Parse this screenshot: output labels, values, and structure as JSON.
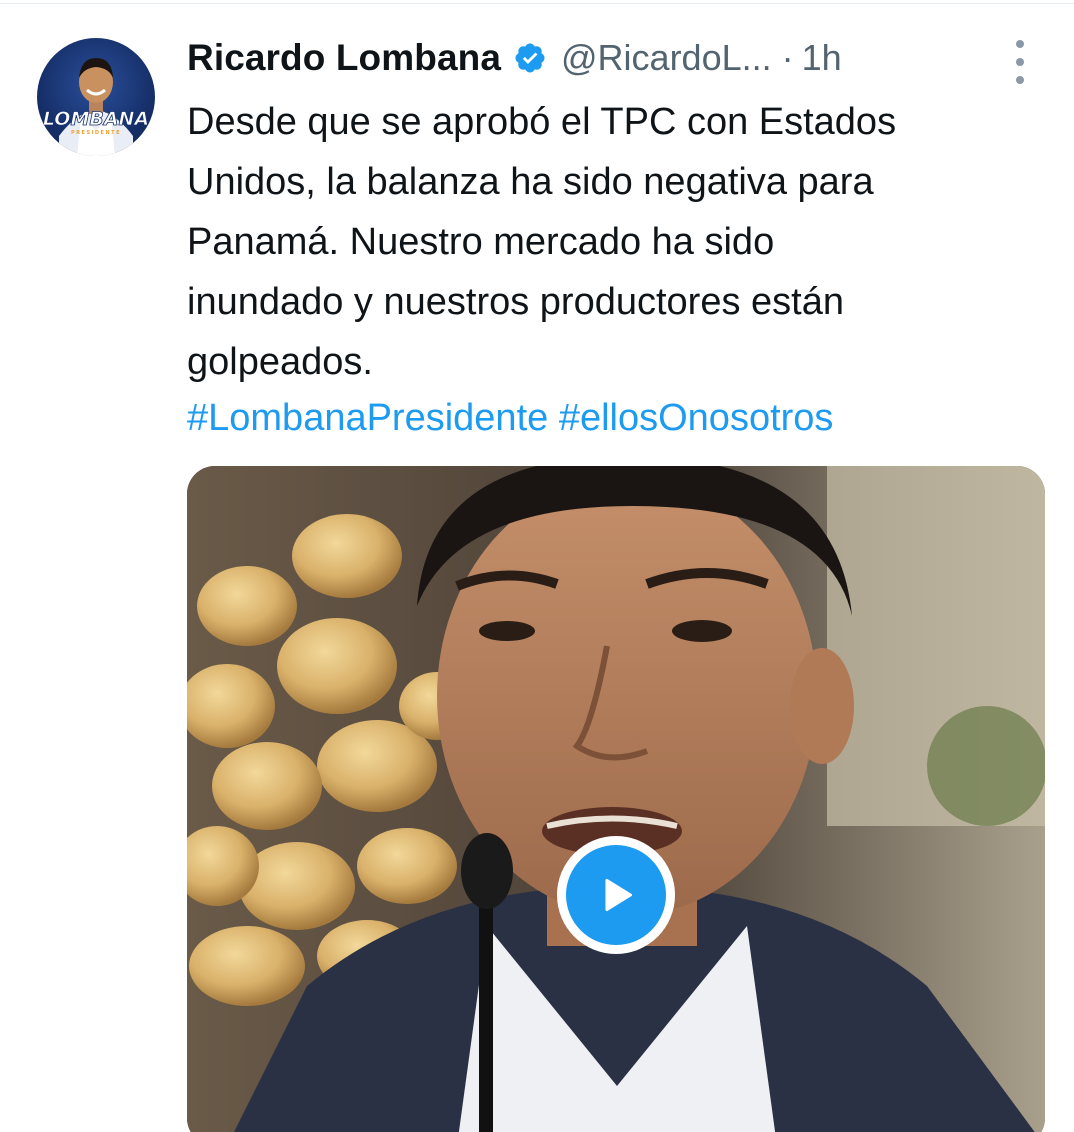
{
  "tweet": {
    "author": {
      "display_name": "Ricardo Lombana",
      "handle": "@RicardoL...",
      "verified": true,
      "avatar_text": "LOMBANA",
      "avatar_subtext": "PRESIDENTE"
    },
    "separator": "·",
    "time": "1h",
    "text_lines": [
      "Desde que se aprobó el TPC con Estados",
      "Unidos, la balanza ha sido negativa para",
      "Panamá. Nuestro mercado ha sido",
      "inundado y nuestros productores están",
      "golpeados."
    ],
    "hashtags": [
      "#LombanaPresidente",
      "#ellosOnosotros"
    ],
    "media": {
      "type": "video",
      "play_icon": "play-icon"
    }
  },
  "colors": {
    "link": "#1d9bf0",
    "secondary_text": "#536471",
    "primary_text": "#0f1419",
    "avatar_bg": "#17306b"
  },
  "icons": {
    "verified": "verified-badge-icon",
    "more": "more-options-icon"
  }
}
